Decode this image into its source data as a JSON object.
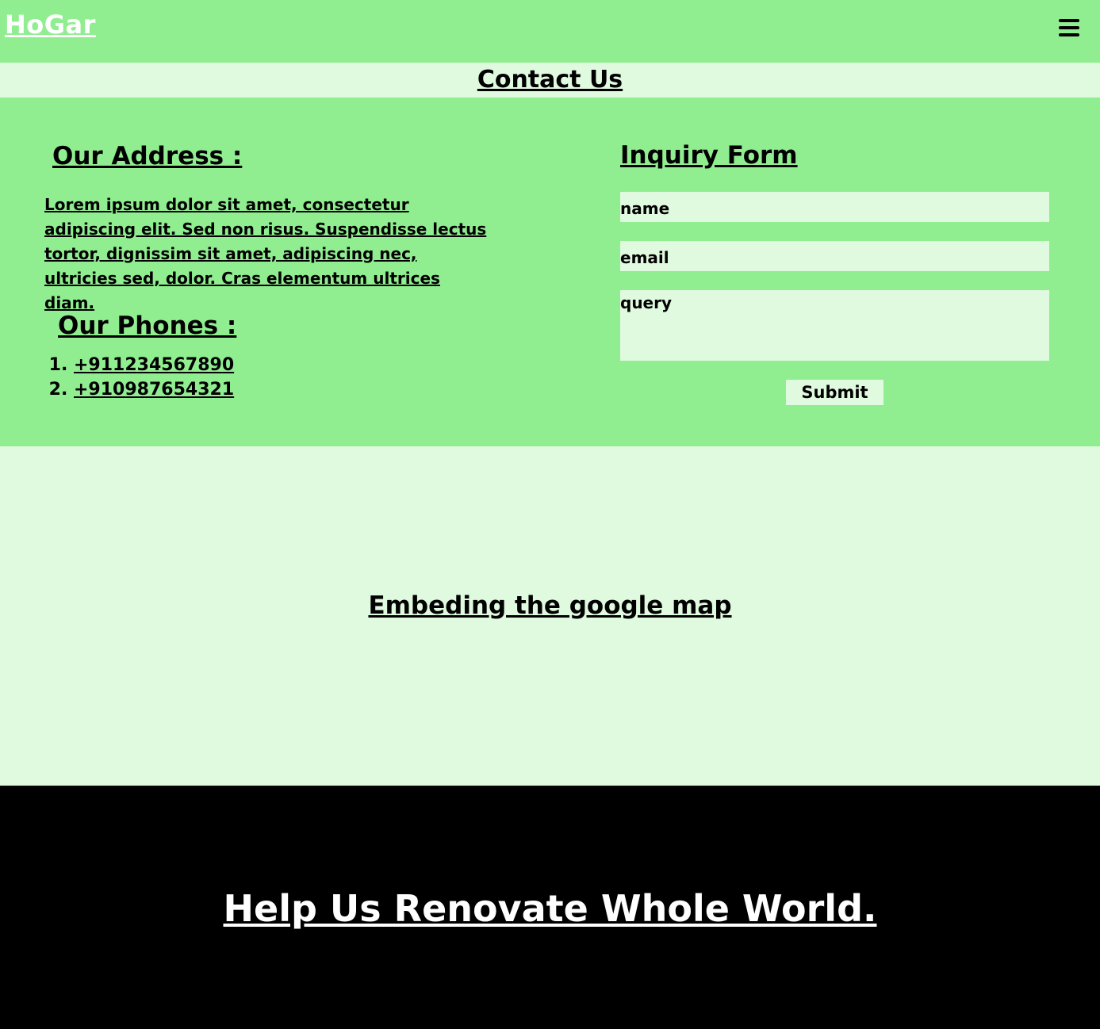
{
  "navbar": {
    "brand": "HoGar",
    "menu_icon": "hamburger-menu-icon"
  },
  "page_title": "Contact Us",
  "address": {
    "heading": "Our Address :",
    "text": "Lorem ipsum dolor sit amet, consectetur adipiscing elit. Sed non risus. Suspendisse lectus tortor, dignissim sit amet, adipiscing nec, ultricies sed, dolor. Cras elementum ultrices diam."
  },
  "phones": {
    "heading": "Our Phones :",
    "items": [
      "+911234567890",
      "+910987654321"
    ]
  },
  "inquiry_form": {
    "heading": "Inquiry Form",
    "name_placeholder": "name",
    "email_placeholder": "email",
    "query_placeholder": "query",
    "submit_label": "Submit"
  },
  "map": {
    "text": "Embeding the google map"
  },
  "footer": {
    "text": "Help Us Renovate Whole World."
  },
  "colors": {
    "green": "#90ee90",
    "light_green": "#e0fadf",
    "footer_bg": "#000000"
  }
}
